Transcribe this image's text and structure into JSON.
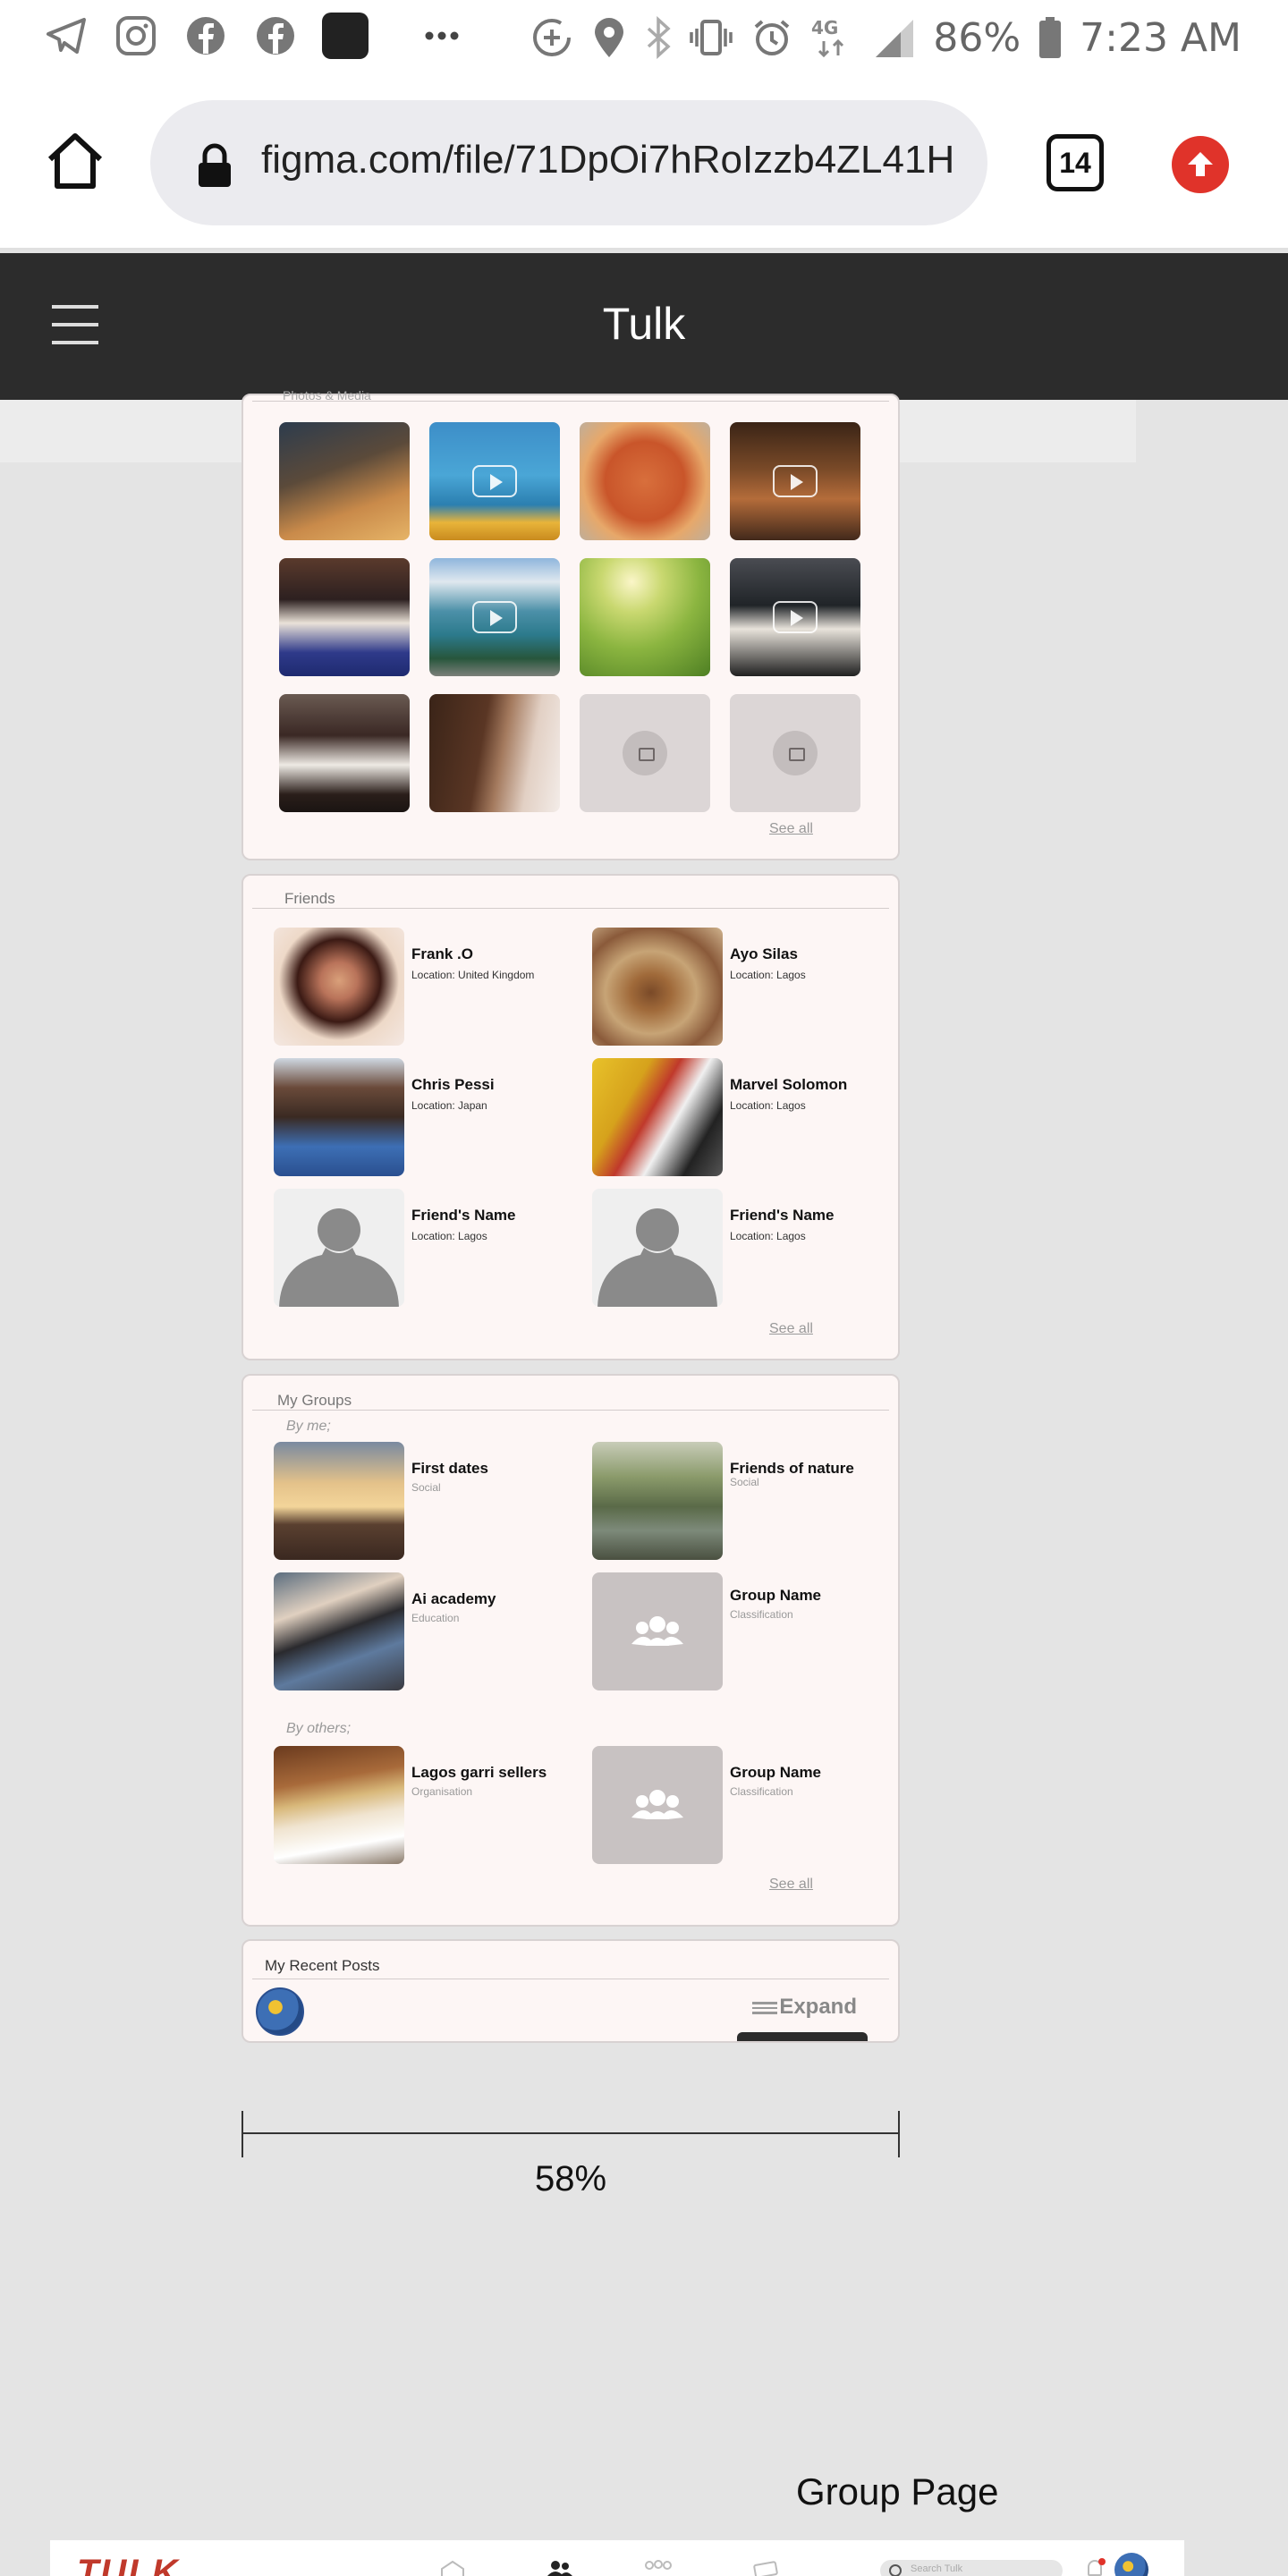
{
  "status_bar": {
    "battery": "86%",
    "time": "7:23 AM",
    "network": "4G",
    "icons": [
      "telegram-icon",
      "instagram-icon",
      "facebook-icon",
      "facebook-icon",
      "app-icon",
      "more-icon",
      "data-saver-icon",
      "location-icon",
      "bluetooth-icon",
      "vibrate-icon",
      "alarm-icon",
      "signal-icon",
      "battery-icon"
    ]
  },
  "browser": {
    "url": "figma.com/file/71DpOi7hRoIzzb4ZL41H",
    "tab_count": "14"
  },
  "app": {
    "title": "Tulk"
  },
  "photos_section": {
    "title": "Photos & Media",
    "see_all": "See all"
  },
  "friends_section": {
    "title": "Friends",
    "see_all": "See all",
    "friends": [
      {
        "name": "Frank .O",
        "location": "Location: United Kingdom"
      },
      {
        "name": "Ayo Silas",
        "location": "Location: Lagos"
      },
      {
        "name": "Chris Pessi",
        "location": "Location: Japan"
      },
      {
        "name": "Marvel Solomon",
        "location": "Location: Lagos"
      },
      {
        "name": "Friend's  Name",
        "location": "Location: Lagos"
      },
      {
        "name": "Friend's  Name",
        "location": "Location: Lagos"
      }
    ]
  },
  "groups_section": {
    "title": "My Groups",
    "by_me_label": "By me;",
    "by_others_label": "By others;",
    "see_all": "See all",
    "by_me": [
      {
        "name": "First dates",
        "classification": "Social"
      },
      {
        "name": "Friends of nature",
        "classification": "Social"
      },
      {
        "name": "Ai academy",
        "classification": "Education"
      },
      {
        "name": "Group Name",
        "classification": "Classification"
      }
    ],
    "by_others": [
      {
        "name": "Lagos garri sellers",
        "classification": "Organisation"
      },
      {
        "name": "Group Name",
        "classification": "Classification"
      }
    ]
  },
  "recent_posts": {
    "title": "My Recent Posts",
    "expand_label": "Expand"
  },
  "canvas": {
    "zoom": "58%",
    "frame_label": "Group Page",
    "bottom_logo": "TULK",
    "bottom_search_placeholder": "Search Tulk"
  },
  "colors": {
    "header_bg": "#2c2c2c",
    "card_bg": "#fdf6f5",
    "accent_red": "#e0332a"
  }
}
